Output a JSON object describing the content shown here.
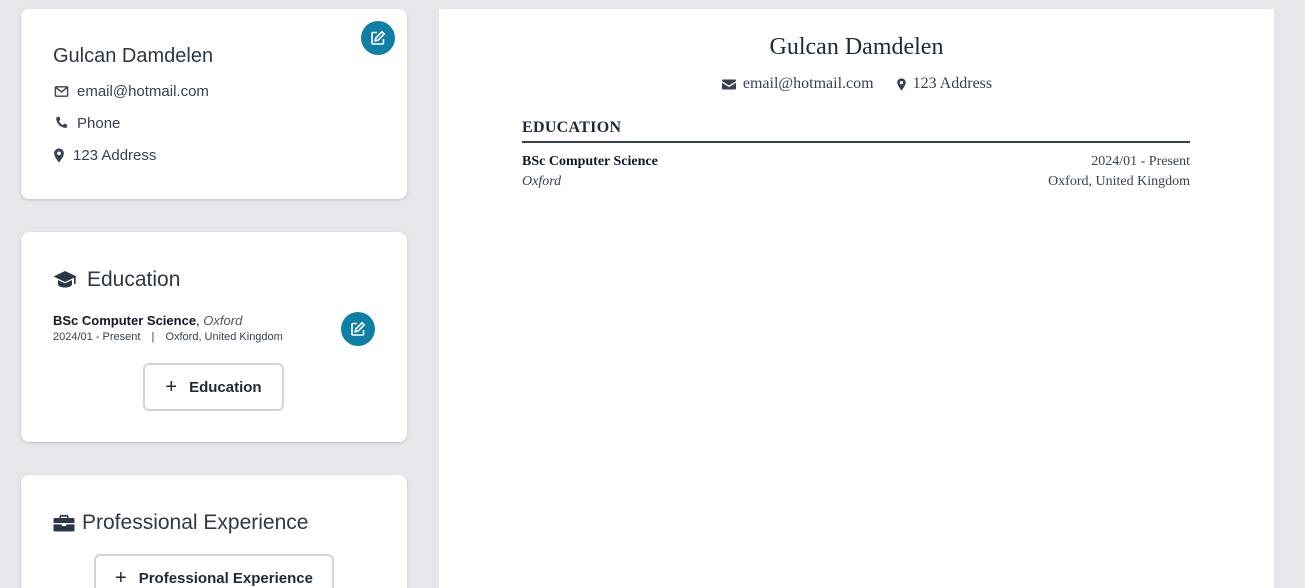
{
  "personal": {
    "name": "Gulcan Damdelen",
    "email": "email@hotmail.com",
    "phone": "Phone",
    "address": "123 Address"
  },
  "education_section": {
    "title": "Education",
    "item": {
      "degree": "BSc Computer Science",
      "separator": ", ",
      "institution": "Oxford",
      "dates": "2024/01 - Present",
      "divider": "|",
      "location": "Oxford, United Kingdom"
    },
    "add_label": "Education"
  },
  "experience_section": {
    "title": "Professional Experience",
    "add_label": "Professional Experience"
  },
  "resume": {
    "name": "Gulcan Damdelen",
    "email": "email@hotmail.com",
    "address": "123 Address",
    "education_heading": "EDUCATION",
    "entry": {
      "degree": "BSc Computer Science",
      "dates": "2024/01 - Present",
      "institution": "Oxford",
      "location": "Oxford, United Kingdom"
    }
  },
  "colors": {
    "accent": "#0f7fa6",
    "background": "#e5e7eb"
  }
}
